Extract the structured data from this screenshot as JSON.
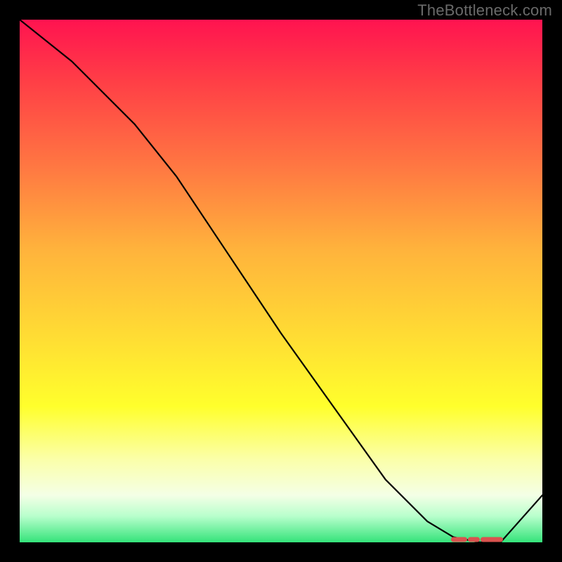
{
  "watermark": "TheBottleneck.com",
  "chart_data": {
    "type": "line",
    "title": "",
    "xlabel": "",
    "ylabel": "",
    "xlim": [
      0,
      100
    ],
    "ylim": [
      0,
      100
    ],
    "series": [
      {
        "name": "curve",
        "x": [
          0,
          10,
          22,
          30,
          40,
          50,
          60,
          70,
          78,
          83,
          88,
          92,
          100
        ],
        "values": [
          100,
          92,
          80,
          70,
          55,
          40,
          26,
          12,
          4,
          1,
          0,
          0,
          9
        ]
      }
    ],
    "highlight": {
      "x_start": 83,
      "x_end": 92,
      "y": 0
    },
    "gradient_stops": [
      {
        "pos": 0.0,
        "color": "#ff1350"
      },
      {
        "pos": 0.28,
        "color": "#ff7742"
      },
      {
        "pos": 0.62,
        "color": "#ffe033"
      },
      {
        "pos": 0.84,
        "color": "#fbffa8"
      },
      {
        "pos": 1.0,
        "color": "#34e37a"
      }
    ]
  }
}
